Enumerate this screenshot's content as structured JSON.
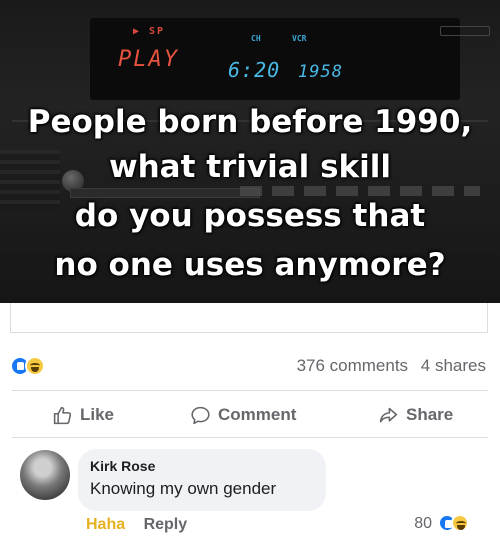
{
  "image": {
    "display": {
      "mode": "▶ SP",
      "play": "PLAY",
      "channel": "CH",
      "vcr": "VCR",
      "clock": "6:20",
      "counter": "1958"
    },
    "headline": [
      "People born before 1990,",
      "what trivial skill",
      "do you possess that",
      "no one uses anymore?"
    ]
  },
  "stats": {
    "comments": "376 comments",
    "shares": "4 shares",
    "reactions": [
      "like-icon",
      "haha-icon"
    ]
  },
  "actions": {
    "like": "Like",
    "comment": "Comment",
    "share": "Share"
  },
  "comment": {
    "author": "Kirk Rose",
    "text": "Knowing my own gender",
    "haha": "Haha",
    "reply": "Reply",
    "reaction_count": "80"
  },
  "colors": {
    "accent": "#1877f2",
    "haha": "#e6b222",
    "muted": "#65676b"
  }
}
